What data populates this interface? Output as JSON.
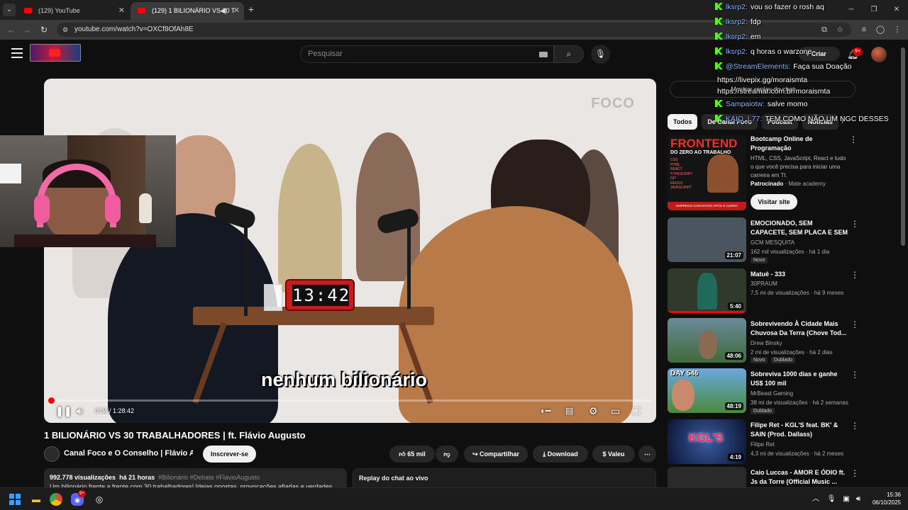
{
  "browser": {
    "tabs": [
      {
        "title": "(129) YouTube",
        "active": false
      },
      {
        "title": "(129) 1 BILIONÁRIO VS 30 T",
        "active": true
      }
    ],
    "url": "youtube.com/watch?v=OXCf8OfAh8E"
  },
  "header": {
    "search_placeholder": "Pesquisar",
    "create_label": "Criar",
    "notifications_count": "9+"
  },
  "player": {
    "brand": "FOCO",
    "clock": "13:42",
    "subtitle": "nenhum bilionário",
    "time": "0:04 / 1:28:42",
    "progress_fraction": 0.001
  },
  "video": {
    "title": "1 BILIONÁRIO VS 30 TRABALHADORES | ft. Flávio Augusto",
    "channel": "Canal Foco e O Conselho | Flávio Au...",
    "subscribe_label": "Inscrever-se",
    "likes": "65 mil",
    "share_label": "Compartilhar",
    "download_label": "Download",
    "thanks_label": "Valeu",
    "views": "992.778 visualizações",
    "age": "há 21 horas",
    "tags": "#Bilionário #Debate #FlavioAugusto",
    "desc_line": "Um bilionário frente a frente com 30 trabalhadores! Ideias opostas, provocações afiadas e verdades",
    "replay_chat": "Replay do chat ao vivo"
  },
  "sidebar": {
    "chat_replay_button": "Mostrar replay do chat",
    "chips": [
      "Todos",
      "De Canal Foco",
      "Podcast",
      "Notícias"
    ],
    "ad": {
      "title": "Bootcamp Online de Programação",
      "desc": "HTML, CSS, JavaScript, React e tudo o que você precisa para iniciar uma carreira em TI.",
      "sponsored": "Patrocinado",
      "advertiser": "Mate academy",
      "button": "Visitar site",
      "thumb_headline": "FRONTEND",
      "thumb_sub": "DO ZERO AO TRABALHO",
      "thumb_list": [
        "CSS",
        "HTML",
        "REACT",
        "TYPESCRIPT",
        "GIT",
        "REDUX",
        "JAVASCRIPT"
      ],
      "thumb_footer": "EMPREGO GARANTIDO APÓS O CURSO"
    },
    "recs": [
      {
        "title": "EMOCIONADO, SEM CAPACETE, SEM PLACA E SEM NOÇÃO: ...",
        "channel": "GCM MESQUITA",
        "meta": "162 mil visualizações · há 1 dia",
        "duration": "21:07",
        "badge": "Novo",
        "thumb_color": "#4a5560",
        "watched": 0
      },
      {
        "title": "Matuê - 333",
        "channel": "30PRAUM",
        "meta": "7,5 mi de visualizações · há 9 meses",
        "duration": "5:40",
        "thumb_color": "#2f3a2c",
        "watched": 1
      },
      {
        "title": "Sobrevivendo À Cidade Mais Chuvosa Da Terra (Chove Tod...",
        "channel": "Drew Binsky",
        "meta": "2 mi de visualizações · há 2 dias",
        "duration": "48:06",
        "badge": "Novo",
        "badge2": "Dublado",
        "thumb_color": "#3f6a3a",
        "watched": 0
      },
      {
        "title": "Sobreviva 1000 dias e ganhe US$ 100 mil",
        "channel": "MrBeast Gaming",
        "meta": "38 mi de visualizações · há 2 semanas",
        "duration": "48:19",
        "badge": "Dublado",
        "thumb_label": "DAY 546",
        "thumb_color": "#4a8a3a",
        "watched": 0
      },
      {
        "title": "Filipe Ret - KGL'S feat. BK' & SAIN (Prod. Dallass)",
        "channel": "Filipe Ret",
        "meta": "4,3 mi de visualizações · há 2 meses",
        "duration": "4:19",
        "thumb_label": "KGL'S",
        "thumb_color": "#1a2a5a",
        "watched": 0
      },
      {
        "title": "Caio Luccas - AMOR E ÓDIO ft. Js da Torre (Official Music ...",
        "channel": "",
        "meta": "",
        "duration": "",
        "thumb_color": "#2a2a2a",
        "watched": 0
      }
    ]
  },
  "chat": [
    {
      "user": "lksrp2:",
      "msg": "vou so fazer o rosh aq"
    },
    {
      "user": "lksrp2:",
      "msg": "fdp"
    },
    {
      "user": "lksrp2:",
      "msg": "em"
    },
    {
      "user": "lksrp2:",
      "msg": "q horas o warzone"
    },
    {
      "user": "@StreamElements:",
      "msg": "Faça sua Doação"
    },
    {
      "user": "",
      "msg": "https://livepix.gg/moraismta",
      "cont": true
    },
    {
      "user": "",
      "msg": "https://streamar.com.br/moraismta",
      "cont": true
    },
    {
      "user": "Sampaiotw:",
      "msg": "salve momo"
    },
    {
      "user": "KAIO_L77:",
      "msg": "TEM COMO NÃO UM NGC DESSES"
    }
  ],
  "taskbar": {
    "time": "15:36",
    "date": "06/10/2025",
    "discord_badge": "9+"
  },
  "colors": {
    "accent": "#ff0000",
    "kick_green": "#53fc18",
    "bg": "#0f0f0f"
  }
}
